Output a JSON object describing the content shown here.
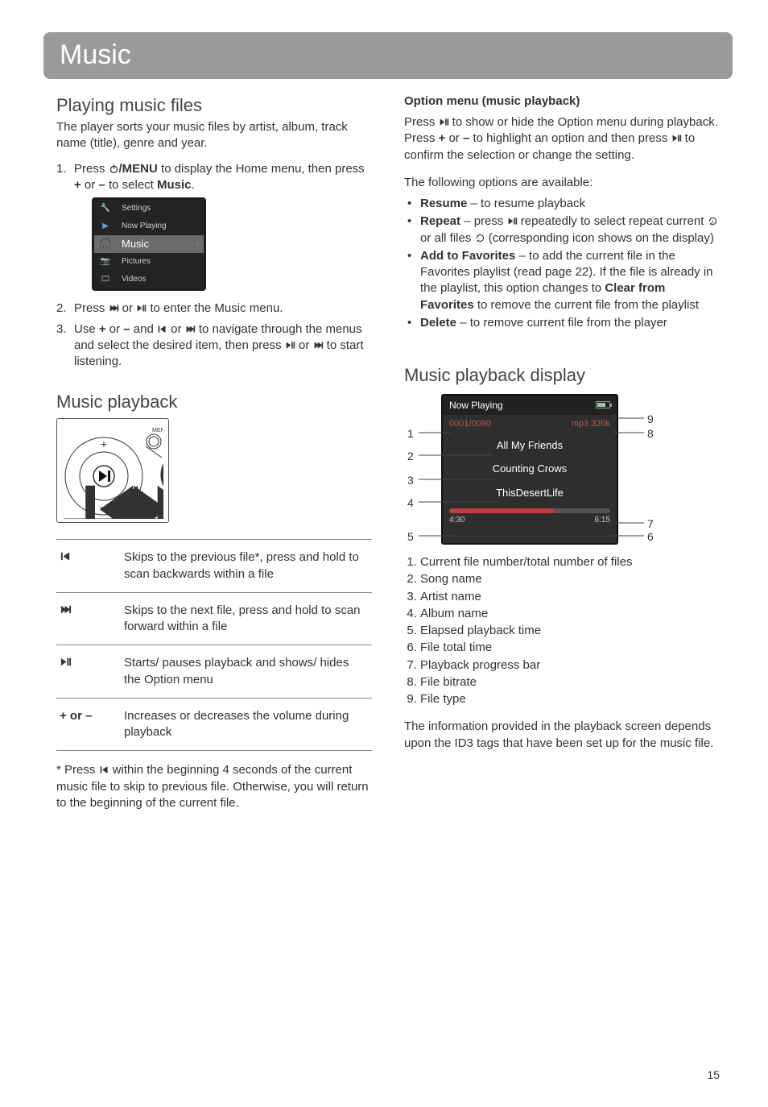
{
  "page_title": "Music",
  "page_number": "15",
  "left": {
    "h2_play": "Playing music files",
    "intro": "The player sorts your music files by artist, album, track name (title), genre and year.",
    "step1a": "Press ",
    "step1b": "/MENU",
    "step1c": " to display the Home menu, then press ",
    "step1_plus": "+",
    "step1d": " or ",
    "step1_minus": "–",
    "step1e": " to select ",
    "step1_music": "Music",
    "step1f": ".",
    "menu_items": [
      "Settings",
      "Now Playing",
      "Music",
      "Pictures",
      "Videos"
    ],
    "step2a": "Press ",
    "step2b": " or ",
    "step2c": " to enter the Music menu.",
    "step3a": "Use ",
    "step3_plus": "+",
    "step3b": " or ",
    "step3_minus": "–",
    "step3c": " and ",
    "step3d": " or ",
    "step3e": " to navigate through the menus and select the desired item, then press ",
    "step3f": " or ",
    "step3g": " to start listening.",
    "h2_playback": "Music playback",
    "controls": [
      {
        "icon": "prev",
        "desc": "Skips to the previous file*, press and hold to scan backwards within a file"
      },
      {
        "icon": "next",
        "desc": "Skips to the next file, press and hold to scan forward within a file"
      },
      {
        "icon": "playpause",
        "desc": "Starts/ pauses playback and shows/ hides the Option menu"
      },
      {
        "icon_text": "+ or –",
        "desc": "Increases or decreases the volume during playback"
      }
    ],
    "footnote": "* Press  within the beginning 4 seconds of the current music file to skip to previous file. Otherwise, you will return to the beginning of the current file.",
    "footnote_pre": "* Press ",
    "footnote_post": " within the beginning 4 seconds of the current music file to skip to previous file. Otherwise, you will return to the beginning of the current file."
  },
  "right": {
    "opt_heading": "Option menu (music playback)",
    "opt_p1a": "Press ",
    "opt_p1b": " to show or hide the Option menu during playback. Press ",
    "opt_plus": "+",
    "opt_p1c": " or ",
    "opt_minus": "–",
    "opt_p1d": " to highlight an option and then press ",
    "opt_p1e": " to confirm the selection or change the setting.",
    "opt_intro": "The following options are available:",
    "opt_resume_b": "Resume",
    "opt_resume": " – to resume playback",
    "opt_repeat_b": "Repeat",
    "opt_repeat1": " – press ",
    "opt_repeat2": " repeatedly to select repeat current ",
    "opt_repeat3": " or all files ",
    "opt_repeat4": "  (corresponding icon shows on the display)",
    "opt_fav_b": "Add to Favorites",
    "opt_fav1": " – to add the current file in the Favorites playlist (read page 22). If the file is already in the playlist, this option changes to ",
    "opt_fav_b2": "Clear from Favorites",
    "opt_fav2": " to remove the current file from the playlist",
    "opt_del_b": "Delete",
    "opt_del": " – to remove current file from the player",
    "h2_display": "Music playback display",
    "np": {
      "title": "Now Playing",
      "counter": "0001/0090",
      "bitrate": "mp3 320k",
      "song": "All My Friends",
      "artist": "Counting Crows",
      "album": "ThisDesertLife",
      "elapsed": "4:30",
      "total": "6:15"
    },
    "legend": [
      "Current file number/total number of files",
      "Song name",
      "Artist name",
      "Album name",
      "Elapsed playback time",
      "File total time",
      "Playback progress bar",
      "File bitrate",
      "File type"
    ],
    "closing": "The information provided in the playback screen depends upon the ID3 tags that have been set up for the music file."
  }
}
